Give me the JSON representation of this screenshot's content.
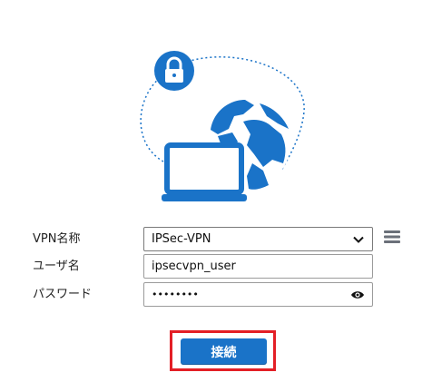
{
  "illustration": {
    "lock_icon": "lock-icon",
    "globe_icon": "globe-icon",
    "laptop_icon": "laptop-icon",
    "accent_color": "#1a73c8"
  },
  "form": {
    "vpn_name_label": "VPN名称",
    "vpn_name_value": "IPSec-VPN",
    "username_label": "ユーザ名",
    "username_value": "ipsecvpn_user",
    "password_label": "パスワード",
    "password_value": "••••••••",
    "menu_icon": "menu-icon",
    "show_password_icon": "eye-icon"
  },
  "actions": {
    "connect_label": "接続",
    "connect_color": "#1a73c8",
    "highlight_color": "#e31f26"
  }
}
